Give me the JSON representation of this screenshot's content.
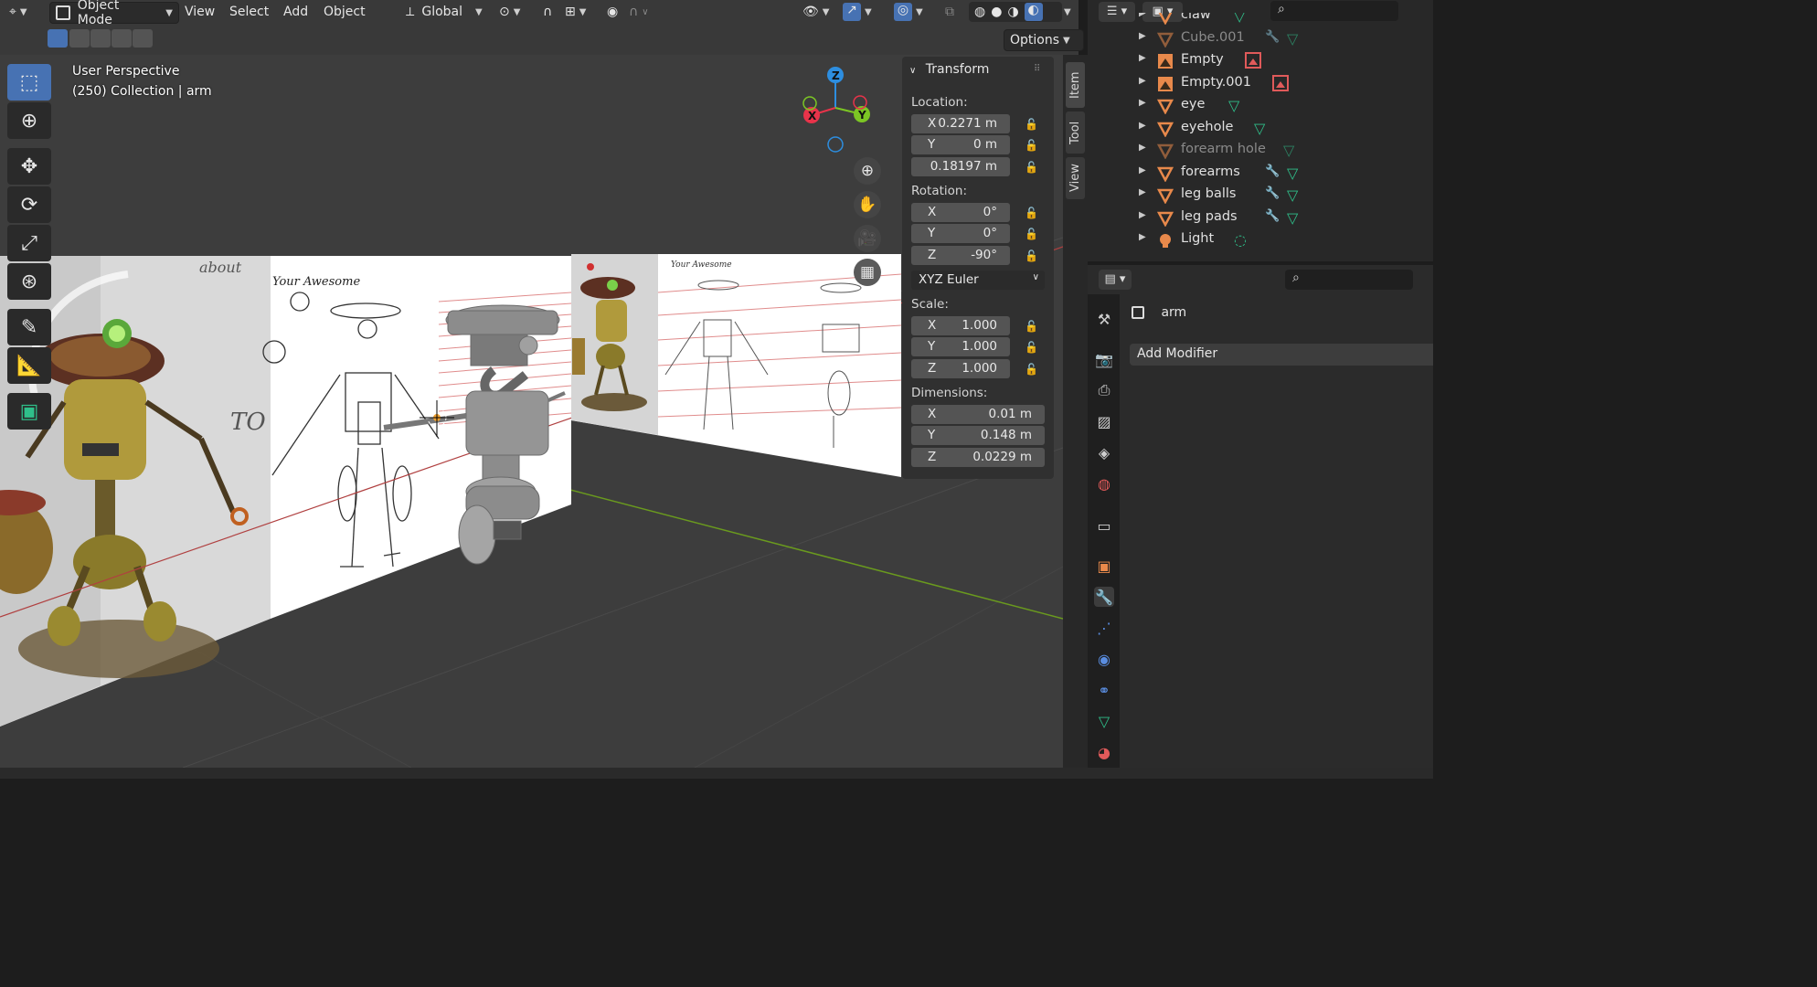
{
  "header": {
    "mode": "Object Mode",
    "menus": [
      "View",
      "Select",
      "Add",
      "Object"
    ],
    "orientation": "Global",
    "options": "Options"
  },
  "viewport": {
    "title": "User Perspective",
    "subtitle": "(250) Collection | arm",
    "gizmo": {
      "z": "Z",
      "x": "X",
      "y": "Y"
    },
    "sketch_text": {
      "about": "about",
      "awesome": "Your Awesome",
      "to": "TO"
    }
  },
  "transform": {
    "header": "Transform",
    "location_label": "Location:",
    "location": [
      {
        "axis": "X",
        "value": "0.2271 m"
      },
      {
        "axis": "Y",
        "value": "0 m"
      },
      {
        "axis": "",
        "value": "0.18197 m"
      }
    ],
    "rotation_label": "Rotation:",
    "rotation": [
      {
        "axis": "X",
        "value": "0°"
      },
      {
        "axis": "Y",
        "value": "0°"
      },
      {
        "axis": "Z",
        "value": "-90°"
      }
    ],
    "rotation_mode": "XYZ Euler",
    "scale_label": "Scale:",
    "scale": [
      {
        "axis": "X",
        "value": "1.000"
      },
      {
        "axis": "Y",
        "value": "1.000"
      },
      {
        "axis": "Z",
        "value": "1.000"
      }
    ],
    "dimensions_label": "Dimensions:",
    "dimensions": [
      {
        "axis": "X",
        "value": "0.01 m"
      },
      {
        "axis": "Y",
        "value": "0.148 m"
      },
      {
        "axis": "Z",
        "value": "0.0229 m"
      }
    ]
  },
  "sidebar_tabs": [
    "Item",
    "Tool",
    "View"
  ],
  "outliner": {
    "rows": [
      {
        "name": "claw",
        "type": "mesh",
        "dim": false,
        "extras": [
          "mesh-data"
        ]
      },
      {
        "name": "Cube.001",
        "type": "mesh",
        "dim": true,
        "extras": [
          "modifier",
          "mesh-data"
        ]
      },
      {
        "name": "Empty",
        "type": "empty",
        "dim": false,
        "extras": [
          "image"
        ]
      },
      {
        "name": "Empty.001",
        "type": "empty",
        "dim": false,
        "extras": [
          "image"
        ]
      },
      {
        "name": "eye",
        "type": "mesh",
        "dim": false,
        "extras": [
          "mesh-data"
        ]
      },
      {
        "name": "eyehole",
        "type": "mesh",
        "dim": false,
        "extras": [
          "mesh-data"
        ]
      },
      {
        "name": "forearm hole",
        "type": "mesh",
        "dim": true,
        "extras": [
          "mesh-data"
        ]
      },
      {
        "name": "forearms",
        "type": "mesh",
        "dim": false,
        "extras": [
          "modifier",
          "mesh-data"
        ]
      },
      {
        "name": "leg balls",
        "type": "mesh",
        "dim": false,
        "extras": [
          "modifier",
          "mesh-data"
        ]
      },
      {
        "name": "leg pads",
        "type": "mesh",
        "dim": false,
        "extras": [
          "modifier",
          "mesh-data"
        ]
      },
      {
        "name": "Light",
        "type": "light",
        "dim": false,
        "extras": [
          "light-data"
        ]
      }
    ]
  },
  "properties": {
    "object_name": "arm",
    "add_modifier": "Add Modifier"
  },
  "colors": {
    "accent": "#4772b3",
    "mesh_icon": "#e8894b",
    "data_icon": "#2fbf8a",
    "modifier_icon": "#5a8de0",
    "image_icon": "#e05a5a",
    "axis_x": "#e8334a",
    "axis_y": "#7cc624",
    "axis_z": "#2d8ee0"
  }
}
